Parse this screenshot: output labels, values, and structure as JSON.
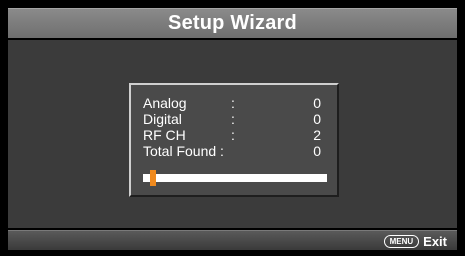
{
  "title": "Setup Wizard",
  "scan": {
    "rows": [
      {
        "label": "Analog",
        "colon": ":",
        "value": "0"
      },
      {
        "label": "Digital",
        "colon": ":",
        "value": "0"
      },
      {
        "label": "RF CH",
        "colon": ":",
        "value": "2"
      },
      {
        "label": "Total Found :",
        "colon": "",
        "value": "0"
      }
    ],
    "progress_fraction": 0.03
  },
  "footer": {
    "menu_key": "MENU",
    "exit_label": "Exit"
  },
  "colors": {
    "progress_fill": "#f08a1e",
    "background": "#3b3b3b",
    "title_bar": "#7d7d7d"
  }
}
